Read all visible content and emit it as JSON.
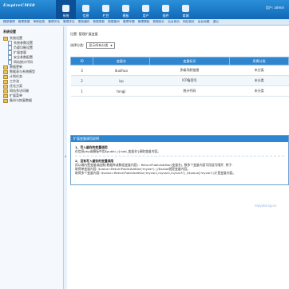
{
  "header": {
    "logo_main": "EmpireCMS",
    "logo_sup": "8",
    "user_info": "用户: admin",
    "nav": [
      {
        "label": "系统",
        "icon": "system-icon",
        "active": true
      },
      {
        "label": "信息",
        "icon": "info-icon"
      },
      {
        "label": "栏目",
        "icon": "column-icon"
      },
      {
        "label": "模板",
        "icon": "template-icon"
      },
      {
        "label": "用户",
        "icon": "user-icon"
      },
      {
        "label": "插件",
        "icon": "plugin-icon"
      },
      {
        "label": "商城",
        "icon": "shop-icon"
      }
    ]
  },
  "subnav": [
    "模型管理",
    "管理数据",
    "审核信息",
    "管理评论",
    "管理评论",
    "更新缓存",
    "数据更新",
    "数据备份",
    "管理专题",
    "管理模板",
    "数据统计",
    "后台首页",
    "网站首页",
    "后台地图",
    "退出"
  ],
  "sidebar": {
    "title": "系统设置",
    "items": [
      {
        "label": "系统设置",
        "type": "folder",
        "level": 0
      },
      {
        "label": "系统参数设置",
        "type": "doc",
        "level": 1
      },
      {
        "label": "负载均衡设置",
        "type": "doc",
        "level": 1
      },
      {
        "label": "扩展变量",
        "type": "doc",
        "level": 1
      },
      {
        "label": "安全参数配置",
        "type": "doc",
        "level": 1
      },
      {
        "label": "网站统计代码",
        "type": "doc",
        "level": 1
      },
      {
        "label": "数据更新",
        "type": "folder",
        "level": 0
      },
      {
        "label": "数据表与系统模型",
        "type": "folder",
        "level": 0
      },
      {
        "label": "计划任务",
        "type": "folder",
        "level": 0
      },
      {
        "label": "工作流",
        "type": "folder",
        "level": 0
      },
      {
        "label": "优化方案",
        "type": "folder",
        "level": 0
      },
      {
        "label": "网站多访问端",
        "type": "folder",
        "level": 0
      },
      {
        "label": "扩展菜单",
        "type": "folder",
        "level": 0
      },
      {
        "label": "备份与恢复数据",
        "type": "folder",
        "level": 0
      }
    ]
  },
  "main": {
    "breadcrumb": "位置: 管理扩展变量",
    "filter_label": "选择分类:",
    "filter_value": "显示所有分类",
    "table": {
      "headers": [
        "ID",
        "变量名",
        "变量标识",
        "所属分类"
      ],
      "rows": [
        [
          "3",
          "duolhuo",
          "多级导航链接",
          "未分类"
        ],
        [
          "2",
          "icp",
          "ICP备案号",
          "未分类"
        ],
        [
          "1",
          "tongji",
          "统计代码",
          "未分类"
        ]
      ]
    },
    "panel": {
      "title": "扩展变量调用说明",
      "h1": "1、写入缓存的变量调用",
      "p1": "在信息php或模板中用$public_r['add_变量名']调取变量内容。",
      "h2": "2、没有写入缓存的变量调用",
      "p2": "用以输内置变量或函数(数据库或数组变量内容) : ReturnPublicAddVar(变量名), 数多个变量内容可用逗号隔开, 例子:",
      "p3": "取得单变量内容: $value=ReturnPublicAddVar('myvar'); //$value就是变量内容。",
      "p4": "取得多个变量内容: $value=ReturnPublicAddVar('myvar1,myvar2,myvar3'); //$value['myvar1']才是变量内容。"
    }
  },
  "watermark": "mayubl.og.co"
}
